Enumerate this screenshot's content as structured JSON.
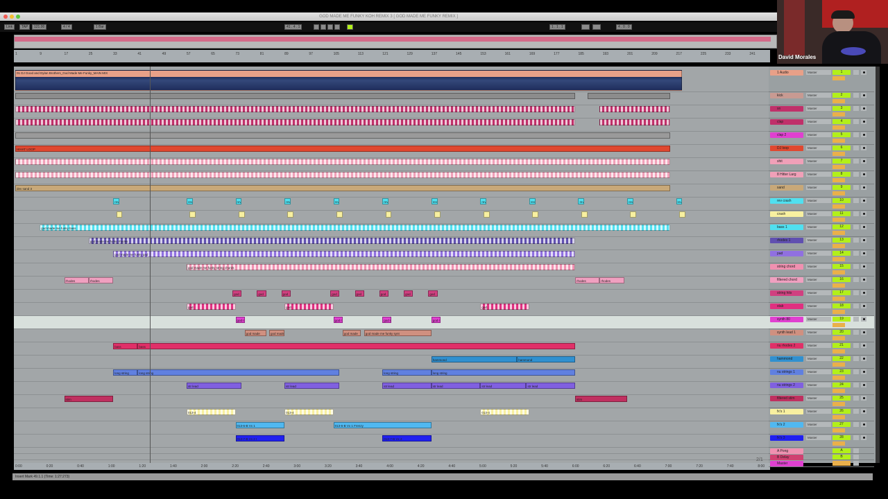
{
  "window": {
    "title": "GOD MADE ME FUNKY KOH REMIX 3 [ GOD MADE ME FUNKY REMIX ]"
  },
  "control_bar": {
    "link": "Link",
    "tap": "TAP",
    "tempo": "121.00",
    "signature": "4 / 4",
    "quantize": "1 Bar",
    "position": "41 . 4 . 1",
    "loop_start": "1 . 1 . 1",
    "loop_length": "4 . 0 . 0",
    "key_midi_accent": "#b2f01a"
  },
  "beat_ruler": [
    "1",
    "9",
    "17",
    "25",
    "33",
    "41",
    "49",
    "57",
    "65",
    "73",
    "81",
    "89",
    "97",
    "105",
    "113",
    "121",
    "129",
    "137",
    "145",
    "153",
    "161",
    "169",
    "177",
    "185",
    "193",
    "201",
    "209",
    "217",
    "225",
    "233",
    "241"
  ],
  "time_ruler": [
    "0:00",
    "0:20",
    "0:40",
    "1:00",
    "1:20",
    "1:40",
    "2:00",
    "2:20",
    "2:40",
    "3:00",
    "3:20",
    "3:40",
    "4:00",
    "4:20",
    "4:40",
    "5:00",
    "5:20",
    "5:40",
    "6:00",
    "6:20",
    "6:40",
    "7:00",
    "7:20",
    "7:40",
    "8:00"
  ],
  "playhead_bar": 45,
  "status": "Insert Mark 49.1.1 (Time: 1:27:273)",
  "page_indicator": "2/1",
  "webcam": {
    "name": "David Morales"
  },
  "mixer_routing": "Master",
  "tracks": [
    {
      "name": "1 Audio",
      "num": "1",
      "color": "#e8a088",
      "h": 33,
      "clips": [
        [
          1,
          219,
          "01 DJ Good and Dylan Brothers_God Made Me Funky_MAIN MIX",
          "wave"
        ]
      ]
    },
    {
      "name": "kick",
      "num": "2",
      "color": "#c89a92",
      "h": 19,
      "clips": [
        [
          1,
          184,
          "",
          "ticks"
        ],
        [
          188,
          215,
          "",
          "ticks"
        ]
      ]
    },
    {
      "name": "sn",
      "num": "3",
      "color": "#c0306a",
      "h": 19,
      "clips": [
        [
          1,
          184,
          "",
          "pat"
        ],
        [
          192,
          215,
          "",
          "pat"
        ]
      ]
    },
    {
      "name": "clap",
      "num": "4",
      "color": "#c0306a",
      "h": 19,
      "clips": [
        [
          1,
          184,
          "",
          "pat"
        ],
        [
          192,
          215,
          "",
          "pat"
        ]
      ]
    },
    {
      "name": "clap 2",
      "num": "5",
      "color": "#e040d0",
      "h": 19,
      "clips": [
        [
          1,
          215,
          "",
          "lines"
        ]
      ]
    },
    {
      "name": "DJ loop",
      "num": "6",
      "color": "#e04830",
      "h": 19,
      "clips": [
        [
          1,
          215,
          "HIHAT LOOP",
          "plain"
        ]
      ]
    },
    {
      "name": "shit",
      "num": "7",
      "color": "#f0a0b8",
      "h": 19,
      "clips": [
        [
          1,
          215,
          "",
          "pat"
        ]
      ]
    },
    {
      "name": "8 Hitter Larg",
      "num": "8",
      "color": "#f0a0b8",
      "h": 19,
      "clips": [
        [
          1,
          215,
          "",
          "pat"
        ]
      ]
    },
    {
      "name": "sand",
      "num": "9",
      "color": "#c8a878",
      "h": 19,
      "clips": [
        [
          1,
          215,
          "dev sand 3",
          "plain"
        ]
      ]
    },
    {
      "name": "rev crash",
      "num": "10",
      "color": "#50e0f0",
      "h": 19,
      "clips": [
        [
          33,
          35,
          "rev",
          "plain"
        ],
        [
          57,
          59,
          "rev",
          "plain"
        ],
        [
          73,
          75,
          "rev",
          "plain"
        ],
        [
          89,
          91,
          "rev",
          "plain"
        ],
        [
          105,
          107,
          "rev",
          "plain"
        ],
        [
          121,
          123,
          "rev",
          "plain"
        ],
        [
          137,
          139,
          "rev",
          "plain"
        ],
        [
          153,
          155,
          "rev",
          "plain"
        ],
        [
          169,
          171,
          "rev",
          "plain"
        ],
        [
          185,
          187,
          "rev",
          "plain"
        ],
        [
          201,
          203,
          "rev",
          "plain"
        ],
        [
          217,
          219,
          "rev",
          "plain"
        ]
      ]
    },
    {
      "name": "crash",
      "num": "11",
      "color": "#f8f0a0",
      "h": 19,
      "clips": [
        [
          34,
          36,
          "",
          "plain"
        ],
        [
          58,
          60,
          "",
          "plain"
        ],
        [
          74,
          76,
          "",
          "plain"
        ],
        [
          90,
          92,
          "",
          "plain"
        ],
        [
          106,
          108,
          "",
          "plain"
        ],
        [
          122,
          124,
          "",
          "plain"
        ],
        [
          138,
          140,
          "",
          "plain"
        ],
        [
          154,
          156,
          "",
          "plain"
        ],
        [
          170,
          172,
          "",
          "plain"
        ],
        [
          186,
          188,
          "",
          "plain"
        ],
        [
          202,
          204,
          "",
          "plain"
        ],
        [
          218,
          220,
          "",
          "plain"
        ]
      ]
    },
    {
      "name": "bass 1",
      "num": "12",
      "color": "#50e0f0",
      "h": 19,
      "clips": [
        [
          9,
          215,
          "god made me funky bass",
          "pat"
        ]
      ]
    },
    {
      "name": "rhodes 1",
      "num": "13",
      "color": "#6050b0",
      "h": 19,
      "clips": [
        [
          25,
          184,
          "god made me funky rhodes",
          "pat"
        ]
      ]
    },
    {
      "name": "pad",
      "num": "14",
      "color": "#9070e0",
      "h": 19,
      "clips": [
        [
          33,
          184,
          "god made me funky pad",
          "pat"
        ]
      ]
    },
    {
      "name": "string chord",
      "num": "15",
      "color": "#f090b0",
      "h": 19,
      "clips": [
        [
          57,
          184,
          "god made me funky string chords",
          "pat"
        ]
      ]
    },
    {
      "name": "filtered chord",
      "num": "16",
      "color": "#f0a0c0",
      "h": 19,
      "clips": [
        [
          17,
          25,
          "rhodes",
          "plain"
        ],
        [
          25,
          33,
          "rhodes",
          "plain"
        ],
        [
          184,
          192,
          "rhodes",
          "plain"
        ],
        [
          192,
          200,
          "rhodes",
          "plain"
        ]
      ]
    },
    {
      "name": "string hits",
      "num": "17",
      "color": "#d04080",
      "h": 19,
      "clips": [
        [
          72,
          75,
          "god",
          "plain"
        ],
        [
          80,
          83,
          "god",
          "plain"
        ],
        [
          88,
          91,
          "god",
          "plain"
        ],
        [
          104,
          107,
          "god",
          "plain"
        ],
        [
          112,
          115,
          "god",
          "plain"
        ],
        [
          120,
          123,
          "god",
          "plain"
        ],
        [
          128,
          131,
          "god",
          "plain"
        ],
        [
          136,
          139,
          "god",
          "plain"
        ]
      ]
    },
    {
      "name": "stab",
      "num": "18",
      "color": "#e03080",
      "h": 19,
      "clips": [
        [
          57,
          73,
          "god",
          "pat"
        ],
        [
          89,
          105,
          "god",
          "pat"
        ],
        [
          153,
          169,
          "god",
          "pat"
        ]
      ]
    },
    {
      "name": "synth 80",
      "num": "19",
      "color": "#e040d0",
      "h": 19,
      "sel": true,
      "clips": [
        [
          73,
          76,
          "god m",
          "plain"
        ],
        [
          105,
          108,
          "god m",
          "plain"
        ],
        [
          121,
          124,
          "god m",
          "plain"
        ],
        [
          137,
          140,
          "god m",
          "plain"
        ]
      ]
    },
    {
      "name": "synth lead 1",
      "num": "20",
      "color": "#d09080",
      "h": 19,
      "clips": [
        [
          76,
          83,
          "god made",
          "plain"
        ],
        [
          84,
          89,
          "god made",
          "plain"
        ],
        [
          108,
          114,
          "god made",
          "plain"
        ],
        [
          115,
          137,
          "god made me funky synt",
          "plain"
        ]
      ]
    },
    {
      "name": "nu rhodes 2",
      "num": "21",
      "color": "#e03068",
      "h": 19,
      "clips": [
        [
          33,
          41,
          "bass",
          "plain"
        ],
        [
          41,
          184,
          "bass",
          "plain"
        ]
      ]
    },
    {
      "name": "hammond",
      "num": "22",
      "color": "#3090d0",
      "h": 19,
      "clips": [
        [
          137,
          165,
          "hammond",
          "plain"
        ],
        [
          165,
          184,
          "hammond",
          "plain"
        ]
      ]
    },
    {
      "name": "nu strings 1",
      "num": "23",
      "color": "#6080e0",
      "h": 19,
      "clips": [
        [
          33,
          41,
          "long string",
          "plain"
        ],
        [
          41,
          107,
          "long string",
          "plain"
        ],
        [
          121,
          137,
          "long string",
          "plain"
        ],
        [
          137,
          184,
          "long string",
          "plain"
        ]
      ]
    },
    {
      "name": "nu strings 2",
      "num": "24",
      "color": "#8060e0",
      "h": 19,
      "clips": [
        [
          57,
          75,
          "str lead",
          "plain"
        ],
        [
          89,
          107,
          "str lead",
          "plain"
        ],
        [
          121,
          137,
          "str lead",
          "plain"
        ],
        [
          137,
          153,
          "str lead",
          "plain"
        ],
        [
          153,
          168,
          "str lead",
          "plain"
        ],
        [
          168,
          184,
          "str lead",
          "plain"
        ]
      ]
    },
    {
      "name": "filtered stim",
      "num": "25",
      "color": "#c03060",
      "h": 19,
      "clips": [
        [
          17,
          33,
          "stim",
          "plain"
        ],
        [
          184,
          201,
          "stim",
          "plain"
        ]
      ]
    },
    {
      "name": "fx's 1",
      "num": "26",
      "color": "#f8f0a0",
      "h": 19,
      "clips": [
        [
          57,
          73,
          "013-4",
          "pat"
        ],
        [
          89,
          105,
          "013-4",
          "pat"
        ],
        [
          153,
          169,
          "013-4",
          "pat"
        ]
      ]
    },
    {
      "name": "fx's 2",
      "num": "27",
      "color": "#50b8f0",
      "h": 19,
      "clips": [
        [
          73,
          89,
          "013-6-B Vx 1",
          "plain"
        ],
        [
          105,
          137,
          "013-6-B Vx 1 Frenzy",
          "plain"
        ]
      ]
    },
    {
      "name": "fx's 3",
      "num": "28",
      "color": "#2020f0",
      "h": 19,
      "clips": [
        [
          73,
          89,
          "013-7-B Vx 2 I",
          "plain"
        ],
        [
          121,
          137,
          "013-7-B Vx 2",
          "plain"
        ]
      ]
    },
    {
      "name": "A Pong",
      "num": "A",
      "color": "#f090b0",
      "h": 9,
      "clips": []
    },
    {
      "name": "B Delay",
      "num": "B",
      "color": "#d04070",
      "h": 9,
      "clips": []
    },
    {
      "name": "Master",
      "num": "",
      "color": "#e040d0",
      "h": 10,
      "clips": []
    }
  ]
}
